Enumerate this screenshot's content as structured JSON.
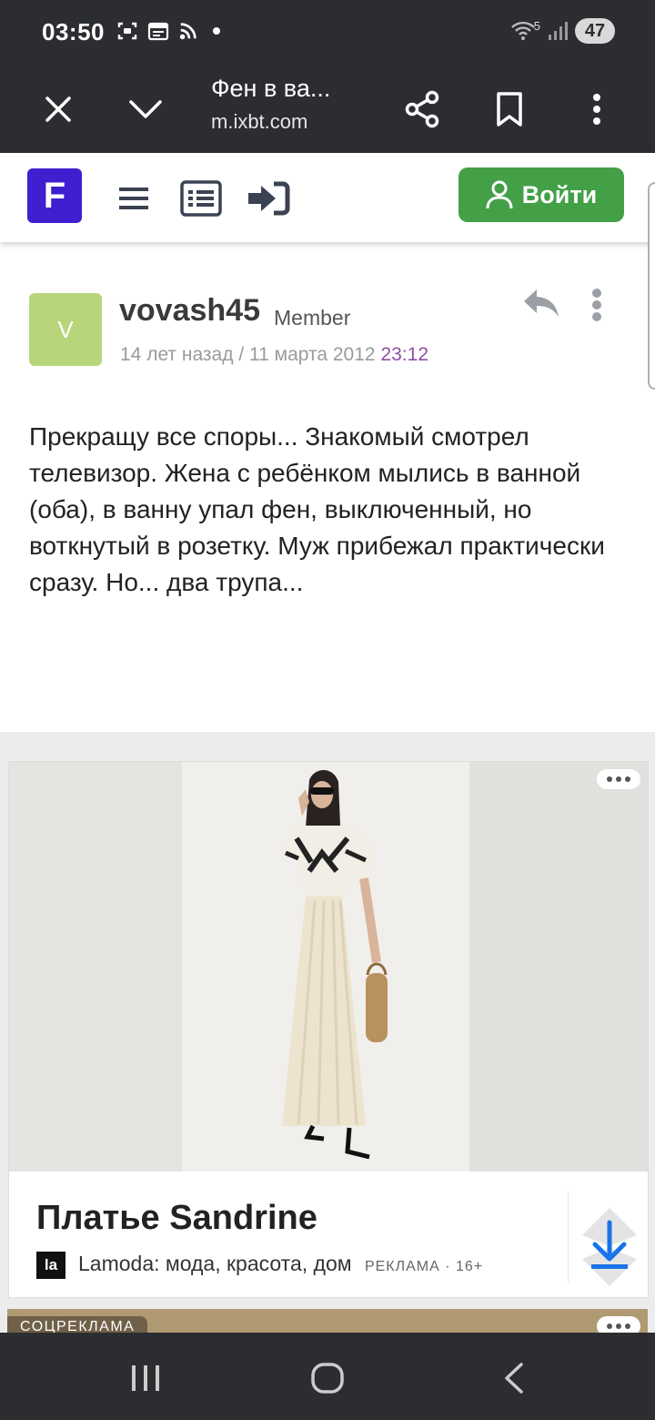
{
  "status_bar": {
    "time": "03:50",
    "battery": "47",
    "network": "5"
  },
  "browser": {
    "page_title": "Фен в ва...",
    "url": "m.ixbt.com"
  },
  "site_header": {
    "logo_letter": "F",
    "login_label": "Войти",
    "login_color": "#43a047",
    "logo_color": "#3f1fd0"
  },
  "post": {
    "avatar_letter": "V",
    "username": "vovash45",
    "role": "Member",
    "relative_time": "14 лет назад",
    "separator": "/",
    "date": "11 марта 2012",
    "time": "23:12",
    "body": "Прекращу все споры... Знакомый смотрел телевизор. Жена с ребёнком мылись в ванной (оба), в ванну упал фен, выключенный, но воткнутый в розетку. Муж прибежал практически сразу. Но... два трупа..."
  },
  "ad": {
    "title": "Платье Sandrine",
    "brand_logo": "la",
    "source": "Lamoda: мода, красота, дом",
    "label": "РЕКЛАМА · 16+"
  },
  "ad2": {
    "label": "СОЦРЕКЛАМА"
  }
}
